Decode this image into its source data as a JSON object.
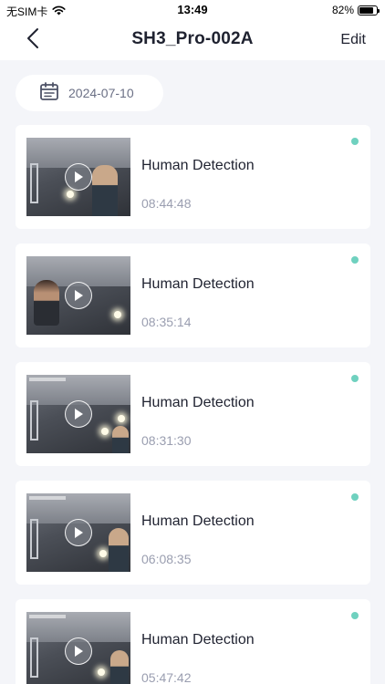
{
  "status_bar": {
    "carrier": "无SIM卡",
    "time": "13:49",
    "battery": "82%",
    "battery_level": 0.82
  },
  "nav": {
    "title": "SH3_Pro-002A",
    "edit_label": "Edit"
  },
  "date_filter": {
    "date": "2024-07-10"
  },
  "colors": {
    "accent_dot": "#6fd1bf",
    "background": "#f4f5f9",
    "muted_text": "#9a9eb0"
  },
  "events": [
    {
      "title": "Human Detection",
      "time": "08:44:48"
    },
    {
      "title": "Human Detection",
      "time": "08:35:14"
    },
    {
      "title": "Human Detection",
      "time": "08:31:30"
    },
    {
      "title": "Human Detection",
      "time": "06:08:35"
    },
    {
      "title": "Human Detection",
      "time": "05:47:42"
    }
  ]
}
